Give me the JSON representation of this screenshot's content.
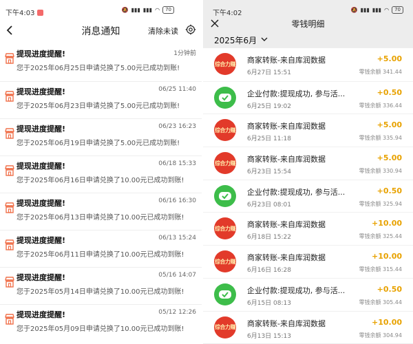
{
  "left": {
    "status": {
      "time": "下午4:03",
      "battery": "70"
    },
    "nav": {
      "title": "消息通知",
      "clear_label": "清除未读"
    },
    "notifications": [
      {
        "title": "提现进度提醒!",
        "time": "1分钟前",
        "body": "您于2025年06月25日申请兑换了5.00元已成功到账!"
      },
      {
        "title": "提现进度提醒!",
        "time": "06/25 11:40",
        "body": "您于2025年06月23日申请兑换了5.00元已成功到账!"
      },
      {
        "title": "提现进度提醒!",
        "time": "06/23 16:23",
        "body": "您于2025年06月19日申请兑换了5.00元已成功到账!"
      },
      {
        "title": "提现进度提醒!",
        "time": "06/18 15:33",
        "body": "您于2025年06月16日申请兑换了10.00元已成功到账!"
      },
      {
        "title": "提现进度提醒!",
        "time": "06/16 16:30",
        "body": "您于2025年06月13日申请兑换了10.00元已成功到账!"
      },
      {
        "title": "提现进度提醒!",
        "time": "06/13 15:24",
        "body": "您于2025年06月11日申请兑换了10.00元已成功到账!"
      },
      {
        "title": "提现进度提醒!",
        "time": "05/16 14:07",
        "body": "您于2025年05月14日申请兑换了10.00元已成功到账!"
      },
      {
        "title": "提现进度提醒!",
        "time": "05/12 12:26",
        "body": "您于2025年05月09日申请兑换了10.00元已成功到账!"
      }
    ]
  },
  "right": {
    "status": {
      "time": "下午4:02",
      "battery": "70"
    },
    "nav": {
      "title": "零钱明细"
    },
    "month_label": "2025年6月",
    "transactions": [
      {
        "type": "merchant",
        "title": "商家转账-来自库润数据",
        "date": "6月27日 15:51",
        "amount": "+5.00",
        "balance": "零钱余额 341.44"
      },
      {
        "type": "wechat",
        "title": "企业付款:提现成功, 参与活...",
        "date": "6月25日 19:02",
        "amount": "+0.50",
        "balance": "零钱余额 336.44"
      },
      {
        "type": "merchant",
        "title": "商家转账-来自库润数据",
        "date": "6月25日 11:18",
        "amount": "+5.00",
        "balance": "零钱余额 335.94"
      },
      {
        "type": "merchant",
        "title": "商家转账-来自库润数据",
        "date": "6月23日 15:54",
        "amount": "+5.00",
        "balance": "零钱余额 330.94"
      },
      {
        "type": "wechat",
        "title": "企业付款:提现成功, 参与活...",
        "date": "6月23日 08:01",
        "amount": "+0.50",
        "balance": "零钱余额 325.94"
      },
      {
        "type": "merchant",
        "title": "商家转账-来自库润数据",
        "date": "6月18日 15:22",
        "amount": "+10.00",
        "balance": "零钱余额 325.44"
      },
      {
        "type": "merchant",
        "title": "商家转账-来自库润数据",
        "date": "6月16日 16:28",
        "amount": "+10.00",
        "balance": "零钱余额 315.44"
      },
      {
        "type": "wechat",
        "title": "企业付款:提现成功, 参与活...",
        "date": "6月15日 08:13",
        "amount": "+0.50",
        "balance": "零钱余额 305.44"
      },
      {
        "type": "merchant",
        "title": "商家转账-来自库润数据",
        "date": "6月13日 15:13",
        "amount": "+10.00",
        "balance": "零钱余额 304.94"
      }
    ],
    "merchant_logo_text": "综合力赚"
  },
  "colors": {
    "amount": "#e8a200",
    "merchant_bg": "#e23a2a",
    "wechat_bg": "#3dbd4a",
    "notif_icon": "#f0704a"
  }
}
